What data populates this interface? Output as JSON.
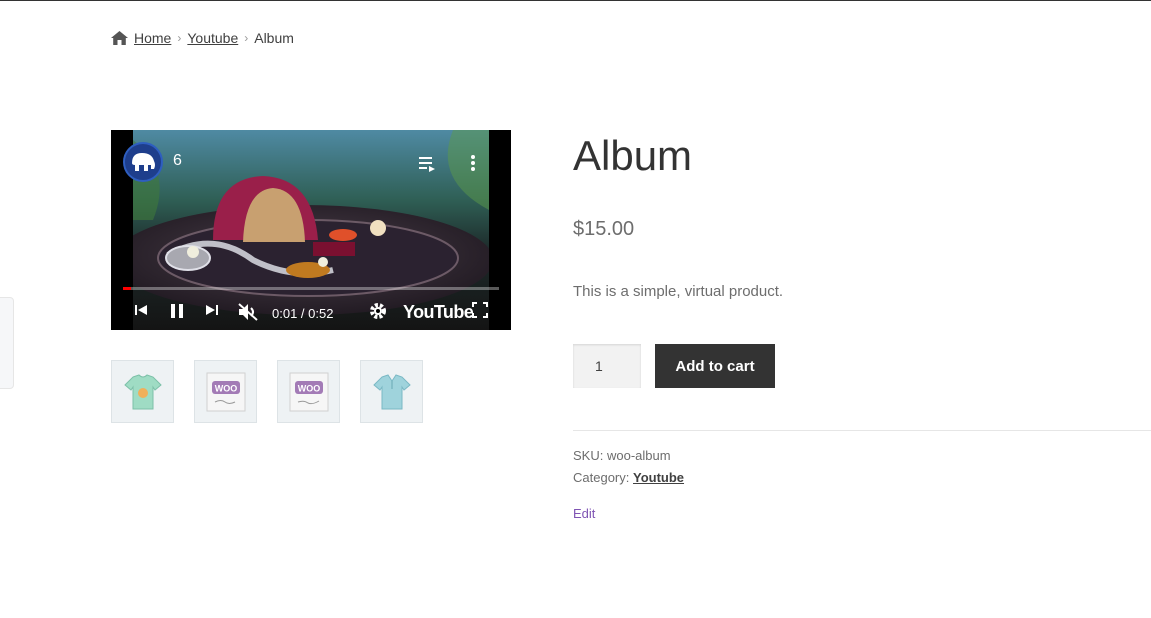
{
  "breadcrumb": {
    "home_icon": "home-icon",
    "home": "Home",
    "category": "Youtube",
    "current": "Album"
  },
  "video": {
    "title": "6",
    "channel_logo": "elephant-logo",
    "time": "0:01 / 0:52",
    "progress": 0.02,
    "brand": "YouTube",
    "muted": true,
    "accent_color": "#ff0000"
  },
  "gallery": {
    "thumbnails": [
      {
        "name": "green t-shirt",
        "icon": "tshirt-icon"
      },
      {
        "name": "woo album 1",
        "icon": "woo-album-icon"
      },
      {
        "name": "woo album 2",
        "icon": "woo-album-icon"
      },
      {
        "name": "polo shirt",
        "icon": "polo-icon"
      }
    ]
  },
  "product": {
    "title": "Album",
    "price": "$15.00",
    "description": "This is a simple, virtual product.",
    "quantity": "1",
    "add_to_cart": "Add to cart",
    "sku_label": "SKU:",
    "sku": "woo-album",
    "category_label": "Category:",
    "category": "Youtube",
    "edit": "Edit"
  },
  "colors": {
    "button_bg": "#333333",
    "link_purple": "#7f54b3",
    "text": "#6d6d6d"
  }
}
